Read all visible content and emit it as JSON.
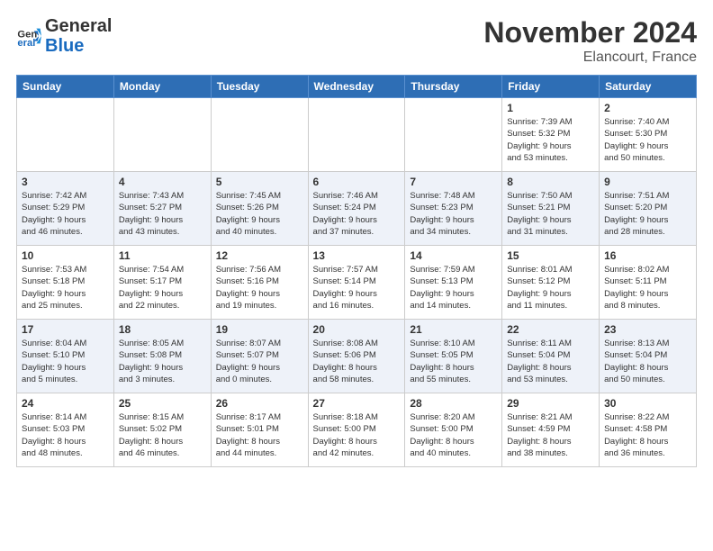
{
  "header": {
    "logo_line1": "General",
    "logo_line2": "Blue",
    "month_title": "November 2024",
    "location": "Elancourt, France"
  },
  "days_of_week": [
    "Sunday",
    "Monday",
    "Tuesday",
    "Wednesday",
    "Thursday",
    "Friday",
    "Saturday"
  ],
  "weeks": [
    [
      {
        "num": "",
        "info": ""
      },
      {
        "num": "",
        "info": ""
      },
      {
        "num": "",
        "info": ""
      },
      {
        "num": "",
        "info": ""
      },
      {
        "num": "",
        "info": ""
      },
      {
        "num": "1",
        "info": "Sunrise: 7:39 AM\nSunset: 5:32 PM\nDaylight: 9 hours\nand 53 minutes."
      },
      {
        "num": "2",
        "info": "Sunrise: 7:40 AM\nSunset: 5:30 PM\nDaylight: 9 hours\nand 50 minutes."
      }
    ],
    [
      {
        "num": "3",
        "info": "Sunrise: 7:42 AM\nSunset: 5:29 PM\nDaylight: 9 hours\nand 46 minutes."
      },
      {
        "num": "4",
        "info": "Sunrise: 7:43 AM\nSunset: 5:27 PM\nDaylight: 9 hours\nand 43 minutes."
      },
      {
        "num": "5",
        "info": "Sunrise: 7:45 AM\nSunset: 5:26 PM\nDaylight: 9 hours\nand 40 minutes."
      },
      {
        "num": "6",
        "info": "Sunrise: 7:46 AM\nSunset: 5:24 PM\nDaylight: 9 hours\nand 37 minutes."
      },
      {
        "num": "7",
        "info": "Sunrise: 7:48 AM\nSunset: 5:23 PM\nDaylight: 9 hours\nand 34 minutes."
      },
      {
        "num": "8",
        "info": "Sunrise: 7:50 AM\nSunset: 5:21 PM\nDaylight: 9 hours\nand 31 minutes."
      },
      {
        "num": "9",
        "info": "Sunrise: 7:51 AM\nSunset: 5:20 PM\nDaylight: 9 hours\nand 28 minutes."
      }
    ],
    [
      {
        "num": "10",
        "info": "Sunrise: 7:53 AM\nSunset: 5:18 PM\nDaylight: 9 hours\nand 25 minutes."
      },
      {
        "num": "11",
        "info": "Sunrise: 7:54 AM\nSunset: 5:17 PM\nDaylight: 9 hours\nand 22 minutes."
      },
      {
        "num": "12",
        "info": "Sunrise: 7:56 AM\nSunset: 5:16 PM\nDaylight: 9 hours\nand 19 minutes."
      },
      {
        "num": "13",
        "info": "Sunrise: 7:57 AM\nSunset: 5:14 PM\nDaylight: 9 hours\nand 16 minutes."
      },
      {
        "num": "14",
        "info": "Sunrise: 7:59 AM\nSunset: 5:13 PM\nDaylight: 9 hours\nand 14 minutes."
      },
      {
        "num": "15",
        "info": "Sunrise: 8:01 AM\nSunset: 5:12 PM\nDaylight: 9 hours\nand 11 minutes."
      },
      {
        "num": "16",
        "info": "Sunrise: 8:02 AM\nSunset: 5:11 PM\nDaylight: 9 hours\nand 8 minutes."
      }
    ],
    [
      {
        "num": "17",
        "info": "Sunrise: 8:04 AM\nSunset: 5:10 PM\nDaylight: 9 hours\nand 5 minutes."
      },
      {
        "num": "18",
        "info": "Sunrise: 8:05 AM\nSunset: 5:08 PM\nDaylight: 9 hours\nand 3 minutes."
      },
      {
        "num": "19",
        "info": "Sunrise: 8:07 AM\nSunset: 5:07 PM\nDaylight: 9 hours\nand 0 minutes."
      },
      {
        "num": "20",
        "info": "Sunrise: 8:08 AM\nSunset: 5:06 PM\nDaylight: 8 hours\nand 58 minutes."
      },
      {
        "num": "21",
        "info": "Sunrise: 8:10 AM\nSunset: 5:05 PM\nDaylight: 8 hours\nand 55 minutes."
      },
      {
        "num": "22",
        "info": "Sunrise: 8:11 AM\nSunset: 5:04 PM\nDaylight: 8 hours\nand 53 minutes."
      },
      {
        "num": "23",
        "info": "Sunrise: 8:13 AM\nSunset: 5:04 PM\nDaylight: 8 hours\nand 50 minutes."
      }
    ],
    [
      {
        "num": "24",
        "info": "Sunrise: 8:14 AM\nSunset: 5:03 PM\nDaylight: 8 hours\nand 48 minutes."
      },
      {
        "num": "25",
        "info": "Sunrise: 8:15 AM\nSunset: 5:02 PM\nDaylight: 8 hours\nand 46 minutes."
      },
      {
        "num": "26",
        "info": "Sunrise: 8:17 AM\nSunset: 5:01 PM\nDaylight: 8 hours\nand 44 minutes."
      },
      {
        "num": "27",
        "info": "Sunrise: 8:18 AM\nSunset: 5:00 PM\nDaylight: 8 hours\nand 42 minutes."
      },
      {
        "num": "28",
        "info": "Sunrise: 8:20 AM\nSunset: 5:00 PM\nDaylight: 8 hours\nand 40 minutes."
      },
      {
        "num": "29",
        "info": "Sunrise: 8:21 AM\nSunset: 4:59 PM\nDaylight: 8 hours\nand 38 minutes."
      },
      {
        "num": "30",
        "info": "Sunrise: 8:22 AM\nSunset: 4:58 PM\nDaylight: 8 hours\nand 36 minutes."
      }
    ]
  ]
}
